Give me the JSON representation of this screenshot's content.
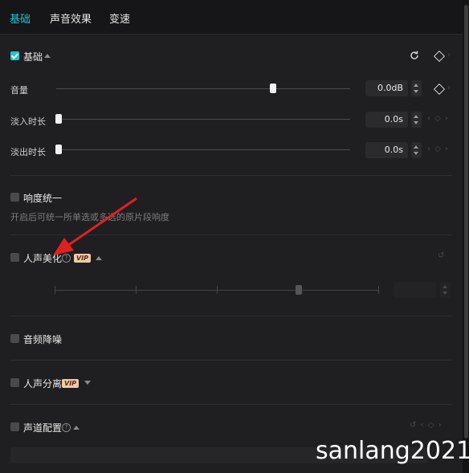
{
  "tabs": [
    {
      "label": "基础",
      "active": true
    },
    {
      "label": "声音效果",
      "active": false
    },
    {
      "label": "变速",
      "active": false
    }
  ],
  "basic": {
    "title": "基础",
    "checked": true,
    "reset_icon": "reset-icon",
    "keyframe_icon": "diamond-icon",
    "rows": [
      {
        "label": "音量",
        "value": "0.0dB",
        "slider_level": 0.73
      },
      {
        "label": "淡入时长",
        "value": "0.0s",
        "slider_level": 0.0
      },
      {
        "label": "淡出时长",
        "value": "0.0s",
        "slider_level": 0.0
      }
    ]
  },
  "loudness": {
    "title": "响度统一",
    "checked": false,
    "description": "开启后可统一所单选或多选的原片段响度"
  },
  "voice_beautify": {
    "title": "人声美化",
    "checked": false,
    "badge": "VIP",
    "help_icon": "question-icon",
    "slider_level": 0.75
  },
  "denoise": {
    "title": "音频降噪",
    "checked": false
  },
  "voice_separation": {
    "title": "人声分离",
    "checked": false,
    "badge": "VIP"
  },
  "channel": {
    "title": "声道配置",
    "checked": false,
    "help_icon": "question-icon"
  },
  "watermark": "sanlang2021",
  "colors": {
    "accent": "#21c4d6",
    "vip_badge": "#f0c9a8",
    "arrow": "#e02020"
  }
}
